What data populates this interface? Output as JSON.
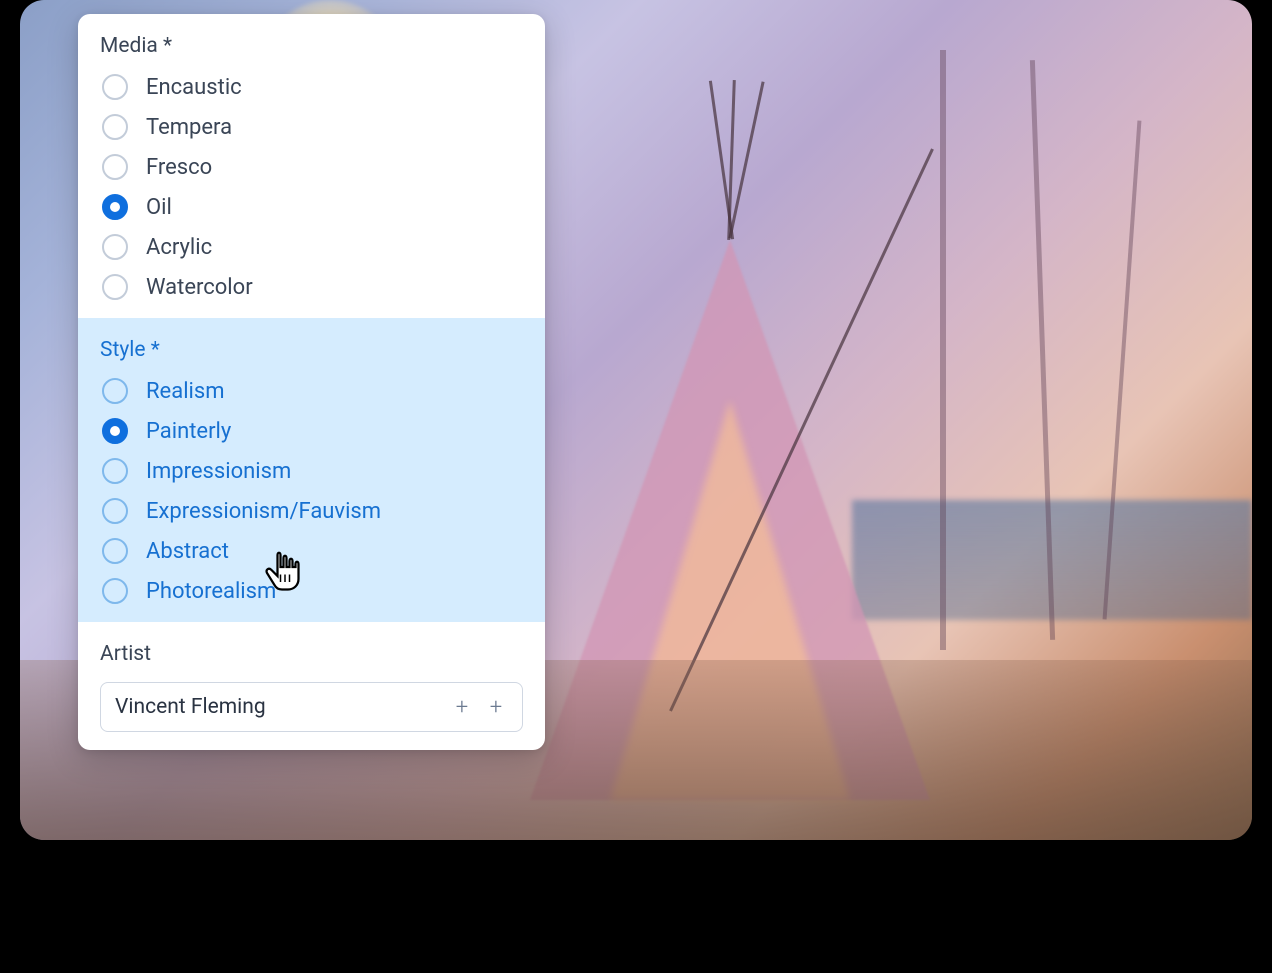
{
  "media": {
    "label": "Media *",
    "options": [
      {
        "label": "Encaustic",
        "selected": false
      },
      {
        "label": "Tempera",
        "selected": false
      },
      {
        "label": "Fresco",
        "selected": false
      },
      {
        "label": "Oil",
        "selected": true
      },
      {
        "label": "Acrylic",
        "selected": false
      },
      {
        "label": "Watercolor",
        "selected": false
      }
    ]
  },
  "style": {
    "label": "Style *",
    "options": [
      {
        "label": "Realism",
        "selected": false
      },
      {
        "label": "Painterly",
        "selected": true
      },
      {
        "label": "Impressionism",
        "selected": false
      },
      {
        "label": "Expressionism/Fauvism",
        "selected": false
      },
      {
        "label": "Abstract",
        "selected": false
      },
      {
        "label": "Photorealism",
        "selected": false
      }
    ]
  },
  "artist": {
    "label": "Artist",
    "value": "Vincent Fleming"
  }
}
